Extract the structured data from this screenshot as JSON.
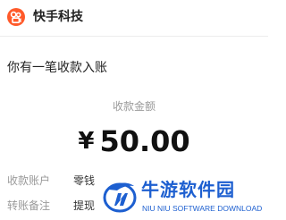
{
  "header": {
    "app_name": "快手科技",
    "logo_icon": "kuaishou-logo-icon",
    "logo_color": "#ff5a2a"
  },
  "message": {
    "title": "你有一笔收款入账"
  },
  "amount": {
    "label": "收款金额",
    "currency": "¥",
    "value": "50.00"
  },
  "details": {
    "account_label": "收款账户",
    "account_value": "零钱",
    "remark_label": "转账备注",
    "remark_value": "提现"
  },
  "watermark": {
    "cn": "牛游软件园",
    "en": "NIU NIU SOFTWARE DOWNLOAD",
    "color": "#1d5fd0"
  }
}
